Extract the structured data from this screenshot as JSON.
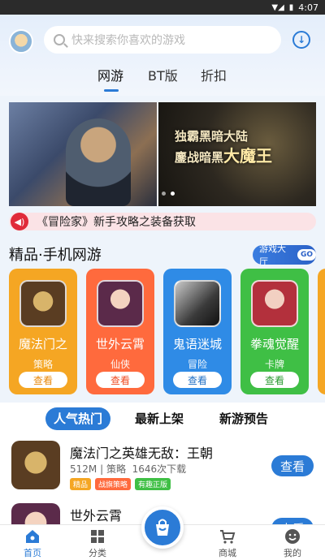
{
  "status_bar": {
    "time": "4:07",
    "signal_icon": "signal-icon",
    "battery_icon": "battery-icon"
  },
  "header": {
    "search_placeholder": "快来搜索你喜欢的游戏",
    "tabs": [
      {
        "label": "网游",
        "active": true
      },
      {
        "label": "BT版",
        "active": false
      },
      {
        "label": "折扣",
        "active": false
      }
    ]
  },
  "banner": {
    "headline_1": "独霸黑暗大陆",
    "headline_2": "鏖战暗黑",
    "headline_big": "大魔王",
    "slides": 2,
    "active_slide": 1
  },
  "notice": {
    "text": "《冒险家》新手攻略之装备获取"
  },
  "featured": {
    "title": "精品·手机网游",
    "hall_label": "游戏大厅",
    "hall_go": "GO",
    "cards": [
      {
        "name": "魔法门之",
        "tag": "策略",
        "button": "查看",
        "bg": "#f5a623",
        "btn_color": "#e8890b"
      },
      {
        "name": "世外云霄",
        "tag": "仙侠",
        "button": "查看",
        "bg": "#ff6a3d",
        "btn_color": "#ef4b22"
      },
      {
        "name": "鬼语迷城",
        "tag": "冒险",
        "button": "查看",
        "bg": "#2f8be6",
        "btn_color": "#1f6fc4"
      },
      {
        "name": "拳魂觉醒",
        "tag": "卡牌",
        "button": "查看",
        "bg": "#3fbf45",
        "btn_color": "#2a9a30"
      }
    ]
  },
  "list_tabs": [
    {
      "label": "人气热门",
      "active": true
    },
    {
      "label": "最新上架",
      "active": false
    },
    {
      "label": "新游预告",
      "active": false
    }
  ],
  "list": [
    {
      "title": "魔法门之英雄无敌：王朝",
      "size": "512M",
      "category": "策略",
      "downloads": "1646次下载",
      "chips": [
        {
          "text": "精品",
          "color": "#f5a623"
        },
        {
          "text": "战旗策略",
          "color": "#ff6a3d"
        },
        {
          "text": "有趣正版",
          "color": "#3fbf45"
        }
      ],
      "button": "查看"
    },
    {
      "title": "世外云霄",
      "button": "查看"
    }
  ],
  "bottom_nav": [
    {
      "label": "首页",
      "active": true
    },
    {
      "label": "分类",
      "active": false
    },
    {
      "label": "商城",
      "active": false
    },
    {
      "label": "我的",
      "active": false
    }
  ]
}
